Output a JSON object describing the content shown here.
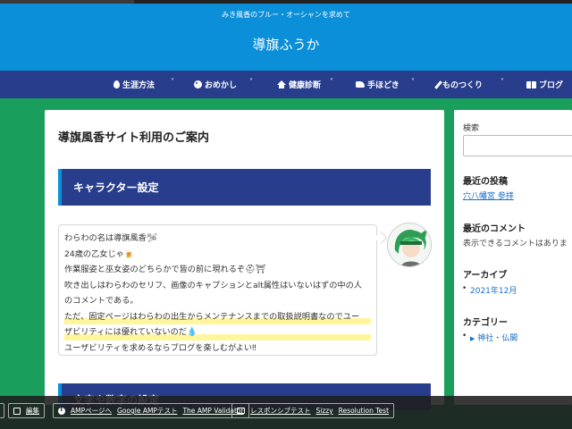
{
  "header": {
    "tagline": "みき風香のブルー・オーシャンを求めて",
    "site_title": "導旗ふうか",
    "colors": {
      "header_bg": "#0a8fd8",
      "nav_bg": "#283e8c",
      "page_bg": "#1a9e5c"
    }
  },
  "nav": {
    "items": [
      {
        "label": "生涯方法",
        "icon": "drop-icon",
        "has_dropdown": true
      },
      {
        "label": "おめかし",
        "icon": "palette-icon",
        "has_dropdown": true
      },
      {
        "label": "健康診断",
        "icon": "house-icon",
        "has_dropdown": true
      },
      {
        "label": "手ほどき",
        "icon": "hands-icon",
        "has_dropdown": true
      },
      {
        "label": "ものつくり",
        "icon": "pencil-icon",
        "has_dropdown": true
      },
      {
        "label": "ブログ",
        "icon": "book-icon",
        "has_dropdown": false
      }
    ],
    "chevron": "˅"
  },
  "article": {
    "title": "導旗風香サイト利用のご案内",
    "section1_heading": "キャラクター設定",
    "bubble_lines": [
      "わらわの名は導旗風香🛩",
      "24歳の乙女じゃ🍺",
      "作業服姿と巫女姿のどちらかで皆の前に現れるぞ⛑⛩",
      "吹き出しはわらわのセリフ、画像のキャプションとalt属性はいないはずの中の人",
      "のコメントである。",
      "ただ、固定ページはわらわの出生からメンテナンスまでの取扱説明書なのでユー",
      "ザビリティには優れていないのだ💧",
      "ユーザビリティを求めるならブログを楽しむがよい‼"
    ],
    "section2_heading": "文字や数字の設定"
  },
  "sidebar": {
    "search_label": "検索",
    "recent_posts_heading": "最近の投稿",
    "recent_posts": [
      "穴八幡宮 参拝"
    ],
    "recent_comments_heading": "最近のコメント",
    "recent_comments_text": "表示できるコメントはありま",
    "archive_heading": "アーカイブ",
    "archives": [
      "2021年12月"
    ],
    "category_heading": "カテゴリー",
    "categories": [
      "神社・仏閣"
    ]
  },
  "admin_bar": {
    "edit_label": "編集",
    "amp_page": "AMPページへ",
    "google_amp_test": "Google AMPテスト",
    "amp_validator": "The AMP Validator",
    "responsive_test": "レスポンシブテスト",
    "sizzy": "Sizzy",
    "resolution_test": "Resolution Test"
  }
}
